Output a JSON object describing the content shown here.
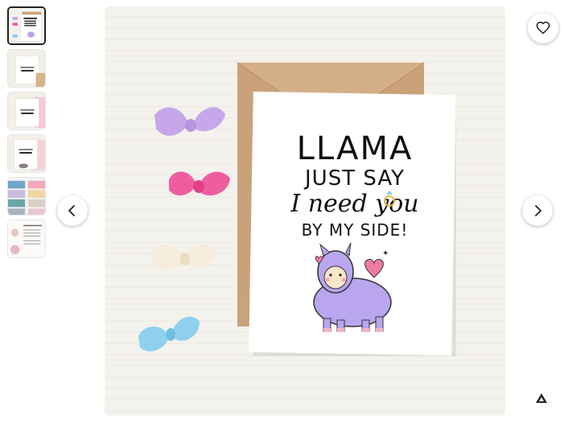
{
  "card": {
    "line1": "LLAMA",
    "line2": "JUST SAY",
    "line3": "I need you",
    "line4": "BY MY SIDE!"
  },
  "thumbnails": [
    {
      "name": "thumbnail-1",
      "active": true
    },
    {
      "name": "thumbnail-2",
      "active": false
    },
    {
      "name": "thumbnail-3",
      "active": false
    },
    {
      "name": "thumbnail-4",
      "active": false
    },
    {
      "name": "thumbnail-5",
      "active": false
    },
    {
      "name": "thumbnail-6",
      "active": false
    }
  ],
  "icons": {
    "previous": "chevron-left-icon",
    "next": "chevron-right-icon",
    "favorite": "heart-icon",
    "zoom": "expand-icon"
  },
  "colors": {
    "background": "#f4f2ed",
    "envelope": "#c9a27a",
    "card": "#ffffff",
    "llama": "#b9a6ef",
    "heart": "#ef7aa0"
  }
}
